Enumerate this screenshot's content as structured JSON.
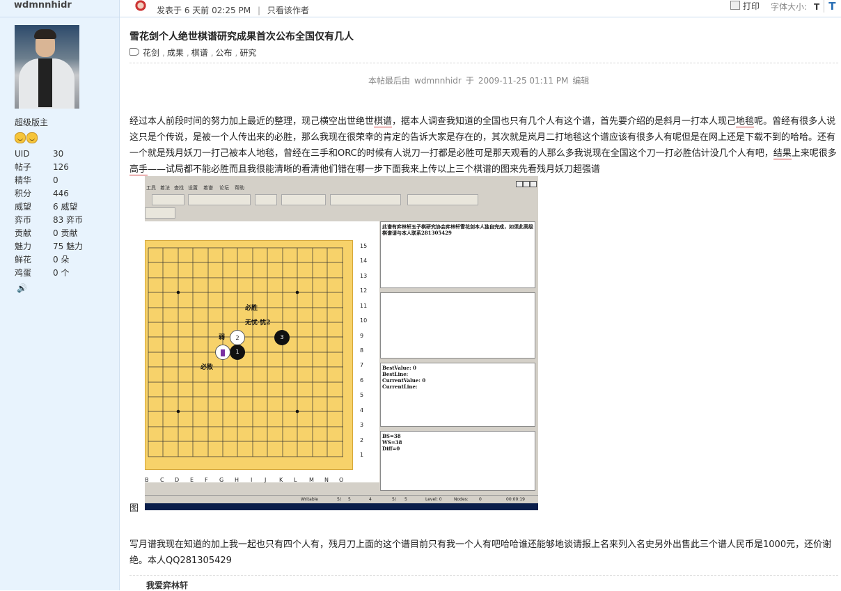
{
  "sidebar": {
    "username": "wdmnnhidr",
    "rank": "超级版主",
    "stats": [
      {
        "key": "UID",
        "value": "30"
      },
      {
        "key": "帖子",
        "value": "126"
      },
      {
        "key": "精华",
        "value": "0"
      },
      {
        "key": "积分",
        "value": "446"
      },
      {
        "key": "威望",
        "value": "6 威望"
      },
      {
        "key": "弈币",
        "value": "83 弈币"
      },
      {
        "key": "贡献",
        "value": "0 贡献"
      },
      {
        "key": "魅力",
        "value": "75 魅力"
      },
      {
        "key": "鲜花",
        "value": "0 朵"
      },
      {
        "key": "鸡蛋",
        "value": "0 个"
      }
    ]
  },
  "header": {
    "posted": "发表于",
    "posted_time": "6 天前 02:25 PM",
    "sep": "|",
    "author_only": "只看该作者",
    "print": "打印",
    "font_size_label": "字体大小:",
    "font_small": "T",
    "font_large": "T"
  },
  "post": {
    "title": "雪花剑个人绝世棋谱研究成果首次公布全国仅有几人",
    "tags": [
      "花剑",
      "成果",
      "棋谱",
      "公布",
      "研究"
    ],
    "edit_note": {
      "prefix": "本帖最后由",
      "user": "wdmnnhidr",
      "middle": "于",
      "time": "2009-11-25 01:11 PM",
      "suffix": "编辑"
    },
    "body_parts": [
      "经过本人前段时间的努力加上最近的整理，现己横空出世绝世",
      "棋谱",
      "，据本人调查我知道的全国也只有几个人有这个谱，首先要介绍的是斜月一打本人现己",
      "地毯",
      "呢。曾经有很多人说这只是个传说，是被一个人传出来的必胜，那么我现在很荣幸的肯定的告诉大家是存在的，其次就是岚月二打",
      "地毯",
      "这个谱应该有很多人有呢但是在网上还是下载不到的哈哈。还有一个就是残月妖刀一打己被本人地毯，曾经在三手和ORC的时候有人说刀一打都是必胜可是那天观看的人那么多我说现在全国这个刀一打必胜估计没几个人有吧，",
      "结果",
      "上来呢很多",
      "高手",
      "——试局都不能必胜而且我很能清晰的看清他们错在哪一步下面我来上传以上三个棋谱的图来先看残月妖刀超强谱"
    ],
    "image_label": "图",
    "body2": "写月谱我现在知道的加上我一起也只有四个人有，残月刀上面的这个谱目前只有我一个人有吧哈哈谁还能够地谈请报上名来列入名史另外出售此三个谱人民币是1000元，还价谢绝。本人QQ281305429",
    "signature": "我爱弈林轩"
  },
  "screenshot": {
    "menu": [
      "工具",
      "着法",
      "查找",
      "设置",
      "着谱",
      "论坛",
      "帮助"
    ],
    "row_numbers": [
      "15",
      "14",
      "13",
      "12",
      "11",
      "10",
      "9",
      "8",
      "7",
      "6",
      "5",
      "4",
      "3",
      "2",
      "1"
    ],
    "col_letters": [
      "B",
      "C",
      "D",
      "E",
      "F",
      "G",
      "H",
      "I",
      "J",
      "K",
      "L",
      "M",
      "N",
      "O"
    ],
    "panel1": "此谱有弈林轩五子棋研究协会弈林轩雪花剑本人独自完成，如须此高级棋谱请与本人联系281305429",
    "panel3": [
      "BestValue:    0",
      "BestLine:",
      "CurrentValue:    0",
      "CurrentLine:"
    ],
    "panel4": [
      "BS=38",
      "WS=38",
      "Diff=0"
    ],
    "annotations": {
      "win": "必胜",
      "nothing": "无忧·忧2",
      "lose": "必败",
      "wei": "弱"
    },
    "stones": [
      {
        "label": "1",
        "color": "black"
      },
      {
        "label": "2",
        "color": "white"
      },
      {
        "label": "3",
        "color": "black"
      }
    ],
    "status": [
      "Writable",
      "5/",
      "5",
      "4",
      "5/",
      "5",
      "Level: 0",
      "Nodes:",
      "0",
      "00:00:19"
    ]
  },
  "colors": {
    "sidebar_bg": "#e8f3fd",
    "board": "#f7d26a",
    "underline": "#cc3333"
  }
}
